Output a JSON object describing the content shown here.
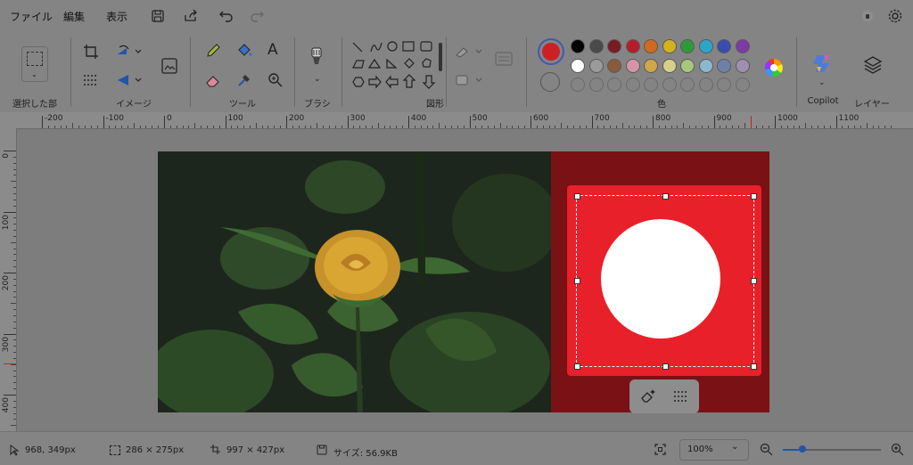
{
  "menu": {
    "file": "ファイル",
    "edit": "編集",
    "view": "表示"
  },
  "ribbon": {
    "selection_label": "選択した部分",
    "image_label": "イメージ",
    "tools_label": "ツール",
    "brush_label": "ブラシ",
    "shapes_label": "図形",
    "color_label": "色",
    "copilot_label": "Copilot",
    "layers_label": "レイヤー",
    "text_tool": "A",
    "primary_color": "#cc2027",
    "palette_row1": [
      "#000000",
      "#4a4a4a",
      "#7a1b24",
      "#b71c2a",
      "#d2691e",
      "#d4b21b",
      "#2e9b3b",
      "#2aa6c9",
      "#3a4cb0",
      "#7b3aa6"
    ],
    "palette_row2": [
      "#ffffff",
      "#9a9a9a",
      "#8a5a3a",
      "#d694a8",
      "#d0a64a",
      "#d6d08a",
      "#a7c878",
      "#8ab8cc",
      "#6f80a8",
      "#a08fb0"
    ]
  },
  "ruler": {
    "top": [
      "-200",
      "-100",
      "0",
      "100",
      "200",
      "300",
      "400",
      "500",
      "600",
      "700",
      "800",
      "900",
      "1000",
      "1100"
    ],
    "left": [
      "0",
      "100",
      "200",
      "300",
      "400"
    ]
  },
  "status": {
    "cursor": "968, 349px",
    "selection_size": "286 × 275px",
    "canvas_size": "997 × 427px",
    "file_size": "サイズ: 56.9KB",
    "zoom": "100%",
    "zoom_level": 0.2
  }
}
